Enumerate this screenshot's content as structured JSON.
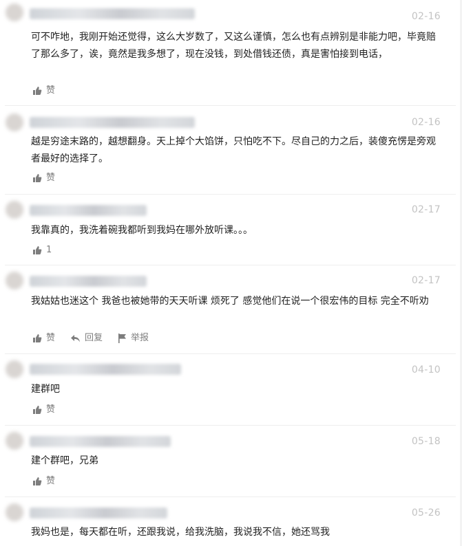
{
  "colors": {
    "text": "#222222",
    "date": "#c3c3c3",
    "action": "#7d7d7d",
    "divider": "#eeeeee"
  },
  "icons": {
    "like": "thumbs-up-icon",
    "reply": "reply-arrow-icon",
    "report": "flag-icon"
  },
  "comments": [
    {
      "date": "02-16",
      "text": "可不咋地，我刚开始还觉得，这么大岁数了，又这么谨慎，怎么也有点辨别是非能力吧，毕竟赔了那么多了，诶，竟然是我多想了，现在没钱，到处借钱还债，真是害怕接到电话，",
      "like_label": "赞"
    },
    {
      "date": "02-16",
      "text": "越是穷途末路的，越想翻身。天上掉个大馅饼，只怕吃不下。尽自己的力之后，装傻充愣是旁观者最好的选择了。",
      "like_label": "赞"
    },
    {
      "date": "02-17",
      "text": "我靠真的，我洗着碗我都听到我妈在哪外放听课。。。",
      "like_label": "1"
    },
    {
      "date": "02-17",
      "text": "我姑姑也迷这个 我爸也被她带的天天听课 烦死了 感觉他们在说一个很宏伟的目标 完全不听劝",
      "like_label": "赞",
      "reply_label": "回复",
      "report_label": "举报"
    },
    {
      "date": "04-10",
      "text": "建群吧",
      "like_label": "赞"
    },
    {
      "date": "05-18",
      "text": "建个群吧，兄弟",
      "like_label": "赞"
    },
    {
      "date": "05-26",
      "text": "我妈也是，每天都在听，还跟我说，给我洗脑，我说我不信，她还骂我"
    }
  ]
}
